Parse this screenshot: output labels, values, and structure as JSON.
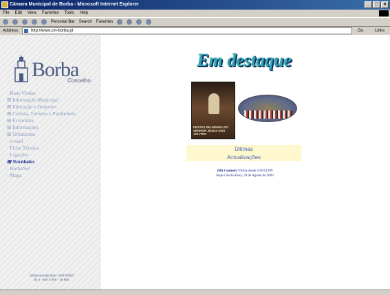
{
  "window": {
    "title": "Câmara Municipal de Borba - Microsoft Internet Explorer",
    "controls": [
      "_",
      "□",
      "×"
    ]
  },
  "menu": [
    "File",
    "Edit",
    "View",
    "Favorites",
    "Tools",
    "Help"
  ],
  "toolbar": {
    "personal_bar": "Personal Bar",
    "search": "Search",
    "favorites": "Favorites"
  },
  "address": {
    "label": "Address",
    "url": "http://www.cm-borba.pt",
    "go": "Go",
    "links": "Links"
  },
  "logo": {
    "word": "Borba",
    "sub": "Concelho"
  },
  "nav": [
    {
      "label": "· Boas Vindas",
      "active": false
    },
    {
      "label": "⊞ Informação Municipal",
      "active": false
    },
    {
      "label": "⊞ Educação e Desporto",
      "active": false
    },
    {
      "label": "⊞ Cultura, Turismo e Património",
      "active": false
    },
    {
      "label": "⊞ Economia",
      "active": false
    },
    {
      "label": "⊞ Informações",
      "active": false
    },
    {
      "label": "⊞ Urbanismo",
      "active": false
    },
    {
      "label": "· e-mail",
      "active": false
    },
    {
      "label": "· Ficha Técnica",
      "active": false
    },
    {
      "label": "· Ligações",
      "active": false
    },
    {
      "label": "⊞ Novidades",
      "active": true
    },
    {
      "label": "· BorbaNet",
      "active": false
    },
    {
      "label": "· Mapa",
      "active": false
    }
  ],
  "update_note": {
    "line1": "Última actualização: 20/07/2003",
    "line2": "IE 5 - 800 X 600 - 16 Bits"
  },
  "headline": "Em destaque",
  "photo_caption": "FESTAS EM HONRA DO SENHOR JESUS DOS AFLITOS",
  "updates": {
    "line1": "Últimas",
    "line2": "Actualizações"
  },
  "counter": {
    "tag": "[Hit Counter]",
    "visits": "Visitas desde 19/03/1999",
    "today": "Hoje é Sexta-Feira, 29 de Agosto de 2003"
  },
  "colors": {
    "title_bar": "#0a246a",
    "nav_link": "#8a9cc4",
    "nav_active": "#1c2c8a",
    "headline": "#37a7b6",
    "updates_bg": "#fff8cf"
  }
}
